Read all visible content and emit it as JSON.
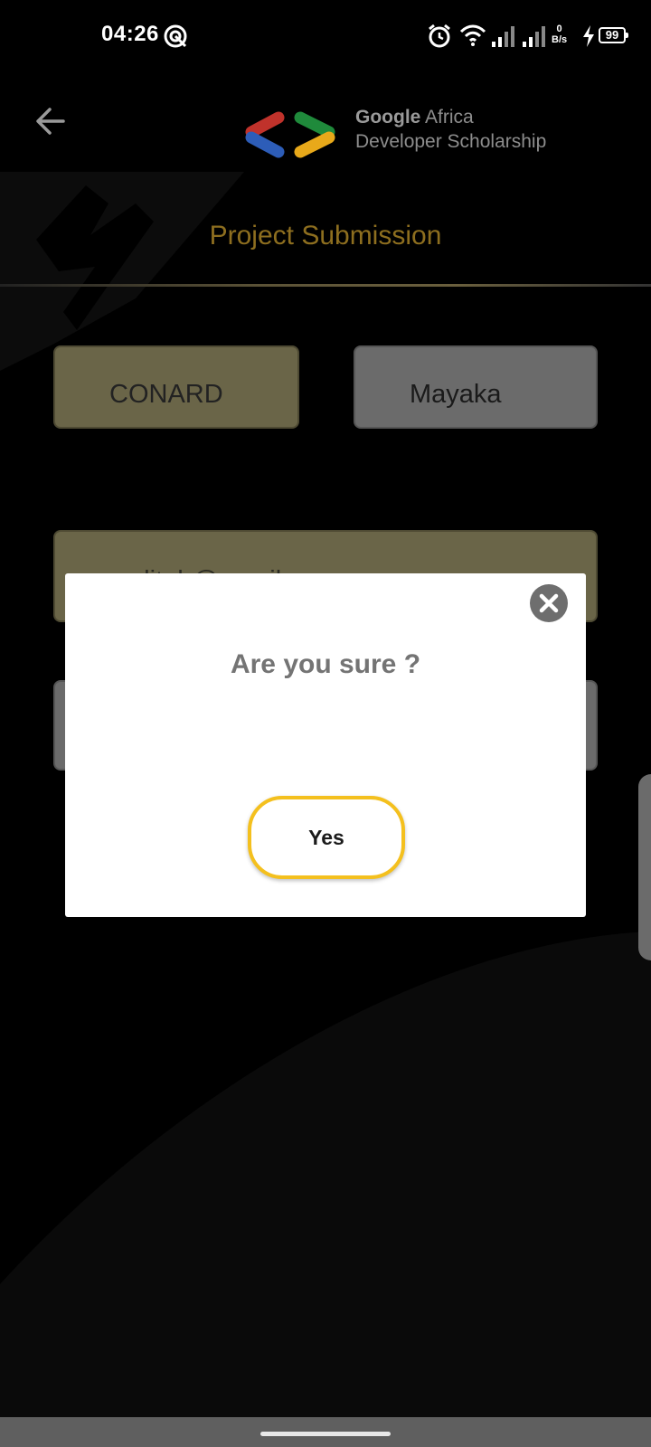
{
  "status_bar": {
    "time": "04:26",
    "net_speed_value": "0",
    "net_speed_unit": "B/s",
    "battery": "99",
    "icons": [
      "do-not-disturb-icon",
      "alarm-icon",
      "wifi-icon",
      "signal-icon",
      "signal-icon",
      "charging-icon",
      "battery-icon"
    ]
  },
  "header": {
    "back_icon": "arrow-left-icon",
    "brand_line1_bold": "Google",
    "brand_line1_rest": " Africa",
    "brand_line2": "Developer Scholarship",
    "page_title": "Project Submission"
  },
  "form": {
    "first_name": "CONARD",
    "last_name": "Mayaka",
    "email": "conarditah@gmail.com",
    "github_link": ""
  },
  "dialog": {
    "title": "Are you sure ?",
    "confirm_label": "Yes",
    "close_icon": "close-icon"
  },
  "colors": {
    "accent": "#8d6e1f",
    "confirm_border": "#f4c01e",
    "field_active": "#6a6548",
    "field_inactive": "#6b6b6b"
  }
}
